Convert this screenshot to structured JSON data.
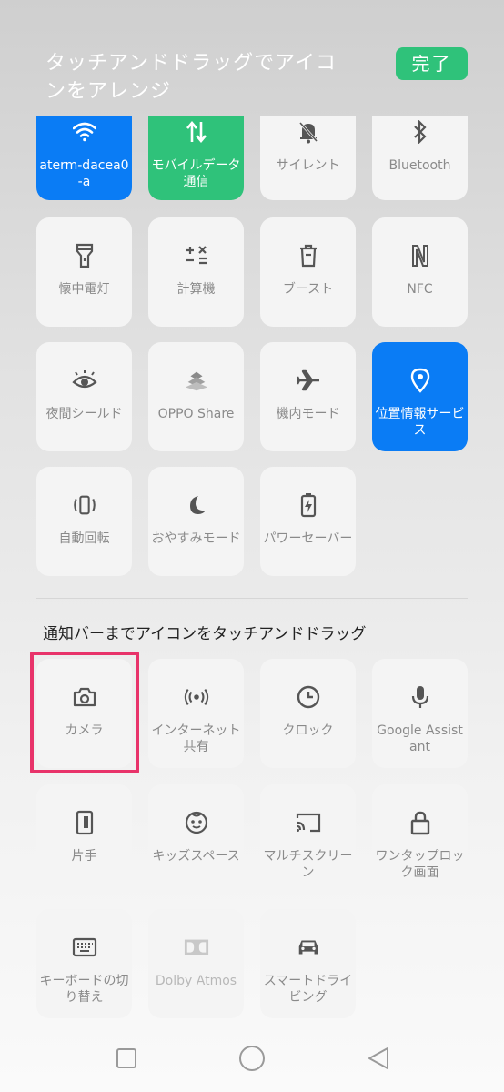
{
  "header": {
    "title": "タッチアンドドラッグでアイコンをアレンジ",
    "done_label": "完了"
  },
  "active_tiles": [
    {
      "label": "aterm-dacea0-a",
      "icon": "wifi-icon",
      "state": "on"
    },
    {
      "label": "モバイルデータ通信",
      "icon": "mobile-data-icon",
      "state": "on"
    },
    {
      "label": "サイレント",
      "icon": "bell-off-icon",
      "state": "off"
    },
    {
      "label": "Bluetooth",
      "icon": "bluetooth-icon",
      "state": "off"
    },
    {
      "label": "懐中電灯",
      "icon": "flashlight-icon",
      "state": "off"
    },
    {
      "label": "計算機",
      "icon": "calculator-icon",
      "state": "off"
    },
    {
      "label": "ブースト",
      "icon": "boost-icon",
      "state": "off"
    },
    {
      "label": "NFC",
      "icon": "nfc-icon",
      "state": "off"
    },
    {
      "label": "夜間シールド",
      "icon": "eye-icon",
      "state": "off"
    },
    {
      "label": "OPPO Share",
      "icon": "oppo-share-icon",
      "state": "off"
    },
    {
      "label": "機内モード",
      "icon": "airplane-icon",
      "state": "off"
    },
    {
      "label": "位置情報サービス",
      "icon": "location-icon",
      "state": "on"
    },
    {
      "label": "自動回転",
      "icon": "rotate-icon",
      "state": "off"
    },
    {
      "label": "おやすみモード",
      "icon": "moon-icon",
      "state": "off"
    },
    {
      "label": "パワーセーバー",
      "icon": "battery-saver-icon",
      "state": "off"
    }
  ],
  "available_section": {
    "title": "通知バーまでアイコンをタッチアンドドラッグ"
  },
  "available_tiles": [
    {
      "label": "カメラ",
      "icon": "camera-icon"
    },
    {
      "label": "インターネット共有",
      "icon": "hotspot-icon"
    },
    {
      "label": "クロック",
      "icon": "clock-icon"
    },
    {
      "label": "Google Assistant",
      "icon": "microphone-icon"
    },
    {
      "label": "片手",
      "icon": "one-hand-icon"
    },
    {
      "label": "キッズスペース",
      "icon": "kids-face-icon"
    },
    {
      "label": "マルチスクリーン",
      "icon": "cast-icon"
    },
    {
      "label": "ワンタップロック画面",
      "icon": "lock-icon"
    },
    {
      "label": "キーボードの切り替え",
      "icon": "keyboard-icon"
    },
    {
      "label": "Dolby Atmos",
      "icon": "dolby-icon"
    },
    {
      "label": "スマートドライビング",
      "icon": "car-icon"
    }
  ],
  "colors": {
    "accent_blue": "#0a7cf5",
    "accent_green": "#2fc27a",
    "highlight": "#e8336a"
  },
  "navbar": {
    "icons": [
      "recent-apps-icon",
      "home-icon",
      "back-icon"
    ]
  }
}
